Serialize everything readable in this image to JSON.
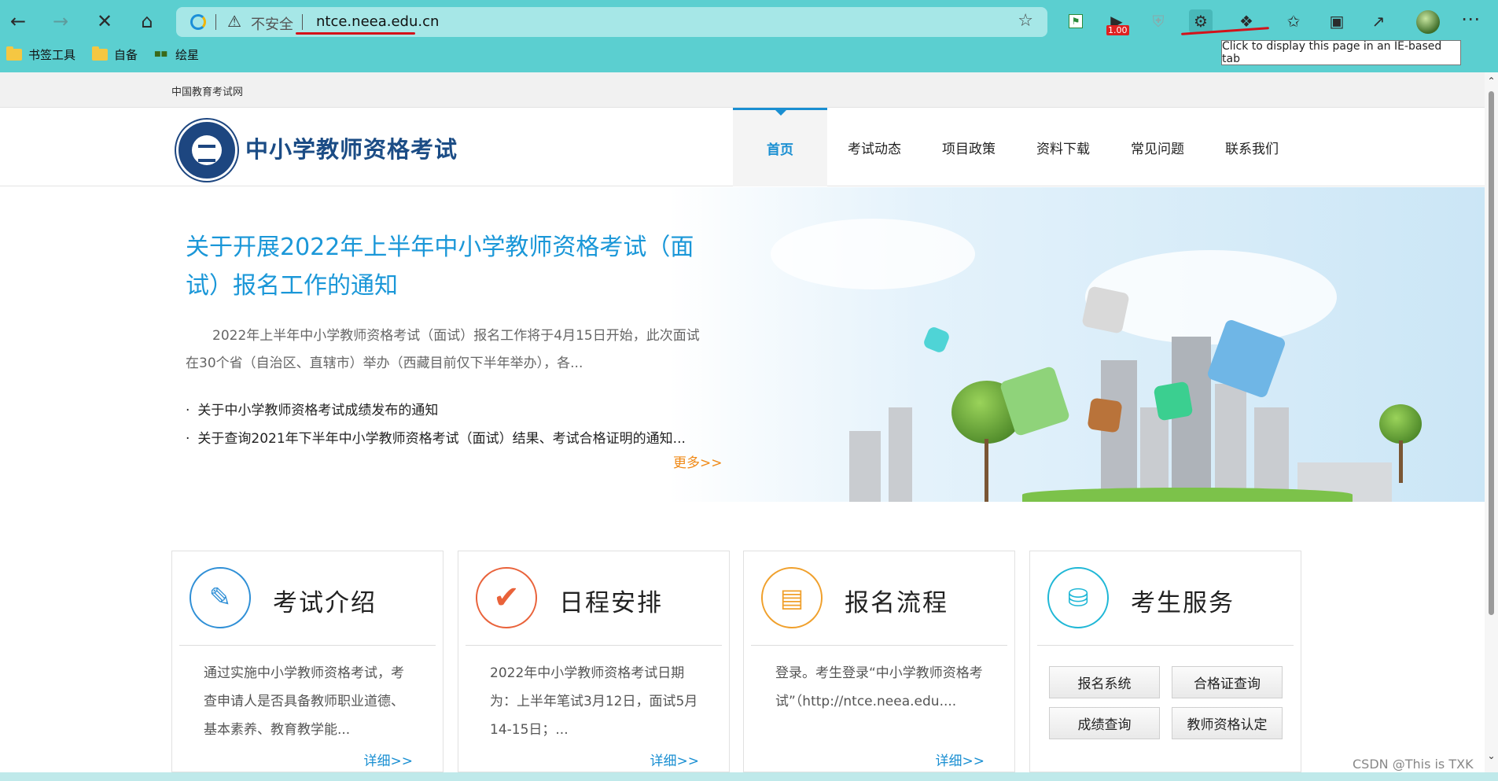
{
  "browser": {
    "address": {
      "security_label": "不安全",
      "url": "ntce.neea.edu.cn"
    },
    "extension_badge": "1.00",
    "tooltip": "Click to display this page in an IE-based tab",
    "bookmarks": [
      {
        "label": "书签工具",
        "icon": "folder-icon"
      },
      {
        "label": "自备",
        "icon": "folder-icon"
      },
      {
        "label": "绘星",
        "icon": "site-icon"
      }
    ],
    "accent_color": "#5bcfd0"
  },
  "page": {
    "top_link": "中国教育考试网",
    "site_title": "中小学教师资格考试",
    "nav": [
      {
        "label": "首页",
        "active": true
      },
      {
        "label": "考试动态",
        "active": false
      },
      {
        "label": "项目政策",
        "active": false
      },
      {
        "label": "资料下载",
        "active": false
      },
      {
        "label": "常见问题",
        "active": false
      },
      {
        "label": "联系我们",
        "active": false
      }
    ],
    "banner": {
      "title": "关于开展2022年上半年中小学教师资格考试（面试）报名工作的通知",
      "description": "2022年上半年中小学教师资格考试（面试）报名工作将于4月15日开始，此次面试在30个省（自治区、直辖市）举办（西藏目前仅下半年举办），各...",
      "links": [
        "关于中小学教师资格考试成绩发布的通知",
        "关于查询2021年下半年中小学教师资格考试（面试）结果、考试合格证明的通知..."
      ],
      "more_label": "更多>>"
    },
    "cards": [
      {
        "title": "考试介绍",
        "icon": "document-pen-icon",
        "text": "通过实施中小学教师资格考试，考查申请人是否具备教师职业道德、基本素养、教育教学能...",
        "detail": "详细>>"
      },
      {
        "title": "日程安排",
        "icon": "checkmark-icon",
        "text": "2022年中小学教师资格考试日期为：上半年笔试3月12日，面试5月14-15日；...",
        "detail": "详细>>"
      },
      {
        "title": "报名流程",
        "icon": "form-edit-icon",
        "text": "登录。考生登录“中小学教师资格考试”（http://ntce.neea.edu....",
        "detail": "详细>>"
      },
      {
        "title": "考生服务",
        "icon": "contact-book-icon",
        "services": [
          "报名系统",
          "合格证查询",
          "成绩查询",
          "教师资格认定"
        ]
      }
    ]
  },
  "watermark": "CSDN @This is TXK"
}
